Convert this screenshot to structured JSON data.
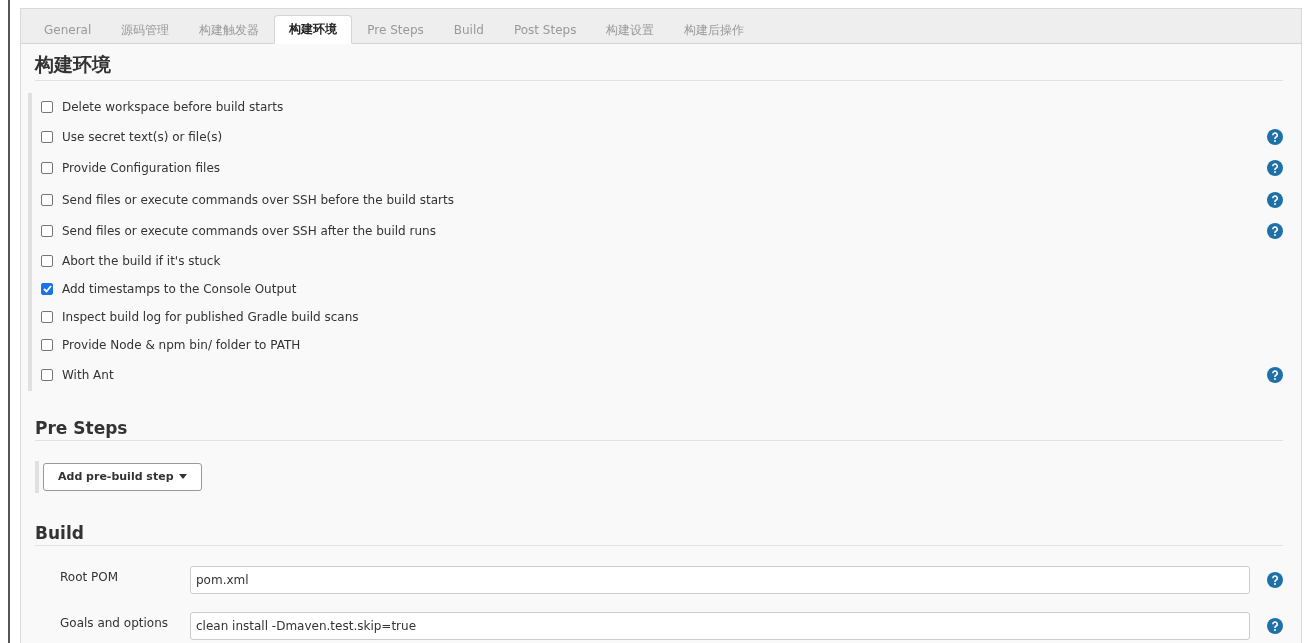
{
  "tabs": [
    {
      "label": "General",
      "selected": false
    },
    {
      "label": "源码管理",
      "selected": false
    },
    {
      "label": "构建触发器",
      "selected": false
    },
    {
      "label": "构建环境",
      "selected": true
    },
    {
      "label": "Pre Steps",
      "selected": false
    },
    {
      "label": "Build",
      "selected": false
    },
    {
      "label": "Post Steps",
      "selected": false
    },
    {
      "label": "构建设置",
      "selected": false
    },
    {
      "label": "构建后操作",
      "selected": false
    }
  ],
  "build_environment": {
    "title": "构建环境",
    "options": [
      {
        "label": "Delete workspace before build starts",
        "checked": false,
        "help": false
      },
      {
        "label": "Use secret text(s) or file(s)",
        "checked": false,
        "help": true
      },
      {
        "label": "Provide Configuration files",
        "checked": false,
        "help": true
      },
      {
        "label": "Send files or execute commands over SSH before the build starts",
        "checked": false,
        "help": true
      },
      {
        "label": "Send files or execute commands over SSH after the build runs",
        "checked": false,
        "help": true
      },
      {
        "label": "Abort the build if it's stuck",
        "checked": false,
        "help": false
      },
      {
        "label": "Add timestamps to the Console Output",
        "checked": true,
        "help": false
      },
      {
        "label": "Inspect build log for published Gradle build scans",
        "checked": false,
        "help": false
      },
      {
        "label": "Provide Node & npm bin/ folder to PATH",
        "checked": false,
        "help": false
      },
      {
        "label": "With Ant",
        "checked": false,
        "help": true
      }
    ]
  },
  "pre_steps": {
    "title": "Pre Steps",
    "button": "Add pre-build step"
  },
  "build": {
    "title": "Build",
    "fields": [
      {
        "label": "Root POM",
        "value": "pom.xml"
      },
      {
        "label": "Goals and options",
        "value": "clean install -Dmaven.test.skip=true"
      }
    ]
  }
}
